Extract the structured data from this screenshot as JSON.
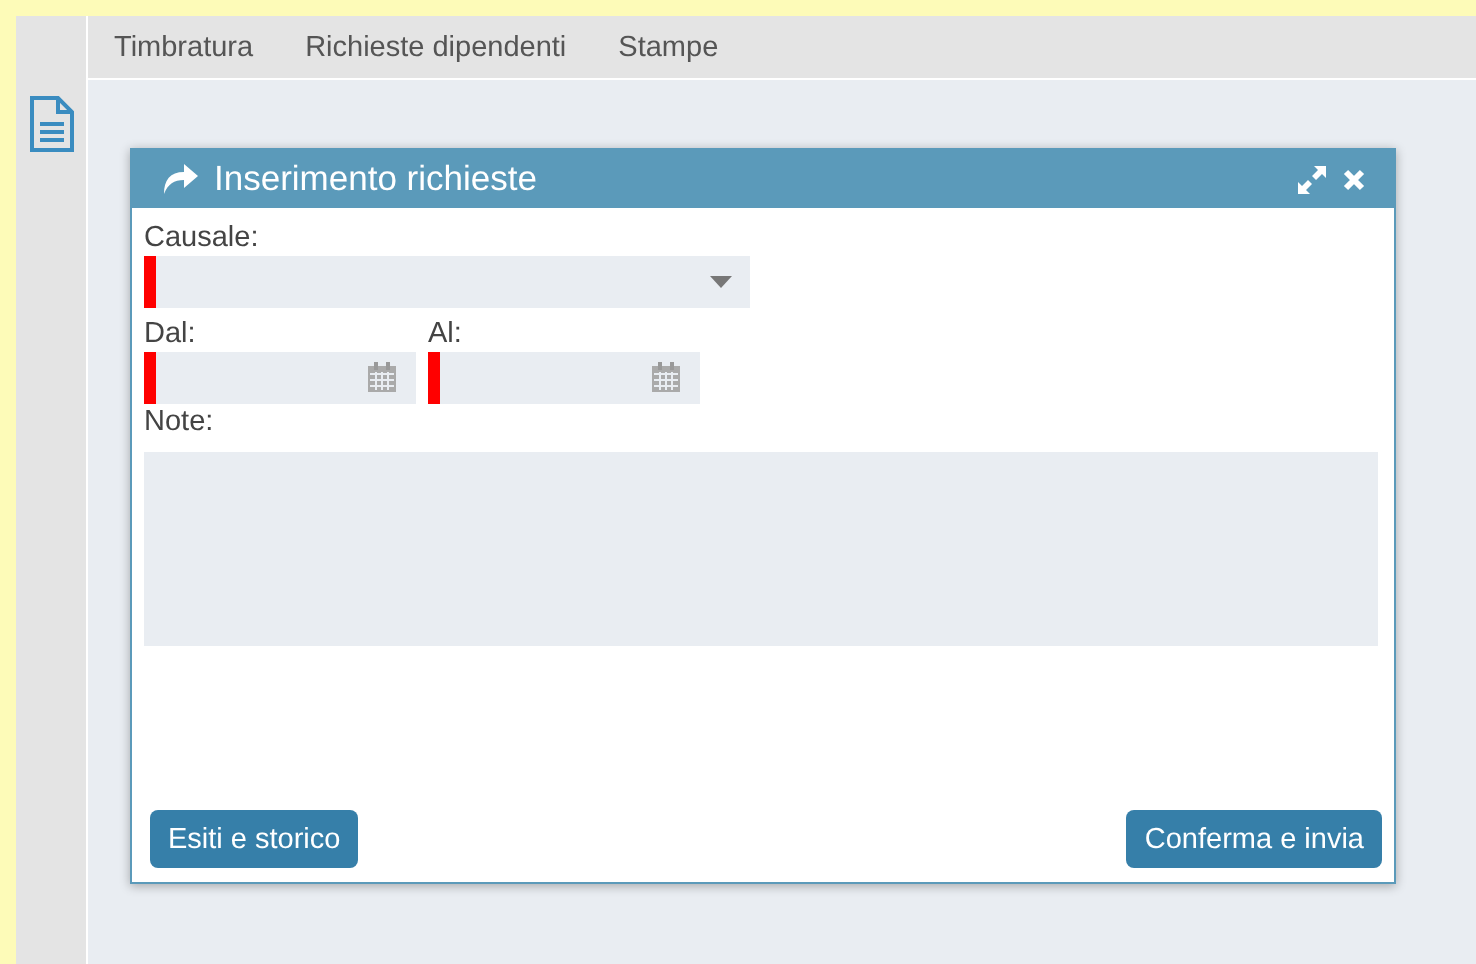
{
  "menu": [
    {
      "label": "Timbratura"
    },
    {
      "label": "Richieste dipendenti"
    },
    {
      "label": "Stampe"
    }
  ],
  "dialog": {
    "title": "Inserimento richieste",
    "fields": [
      {
        "kind": "select",
        "label": "Causale:",
        "required": true
      },
      {
        "kind": "date",
        "label": "Dal:",
        "required": true
      },
      {
        "kind": "date",
        "label": "Al:",
        "required": true
      },
      {
        "kind": "textarea",
        "label": "Note:",
        "required": false
      }
    ],
    "buttons": [
      {
        "label": "Esiti e storico"
      },
      {
        "label": "Conferma e invia"
      }
    ]
  }
}
